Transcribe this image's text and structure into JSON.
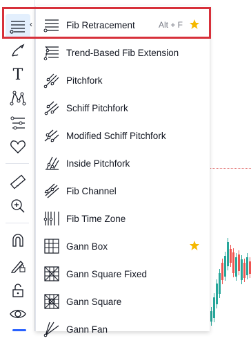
{
  "menu": {
    "items": [
      {
        "label": "Fib Retracement",
        "hotkey": "Alt + F",
        "favorite": true
      },
      {
        "label": "Trend-Based Fib Extension"
      },
      {
        "label": "Pitchfork"
      },
      {
        "label": "Schiff Pitchfork"
      },
      {
        "label": "Modified Schiff Pitchfork"
      },
      {
        "label": "Inside Pitchfork"
      },
      {
        "label": "Fib Channel"
      },
      {
        "label": "Fib Time Zone"
      },
      {
        "label": "Gann Box",
        "favorite": true
      },
      {
        "label": "Gann Square Fixed"
      },
      {
        "label": "Gann Square"
      },
      {
        "label": "Gann Fan"
      }
    ]
  },
  "toolbar": {
    "icons": [
      "fib-tools-icon",
      "brush-icon",
      "text-icon",
      "pattern-icon",
      "prediction-icon",
      "heart-icon",
      "ruler-icon",
      "zoom-in-icon",
      "magnet-icon",
      "lock-drawing-icon",
      "lock-icon",
      "eye-icon"
    ],
    "text_tool_glyph": "T"
  },
  "colors": {
    "highlight": "#d7303a",
    "star": "#f5b800",
    "accent": "#2962ff",
    "candle_up": "#26a69a",
    "candle_down": "#ef5350"
  }
}
